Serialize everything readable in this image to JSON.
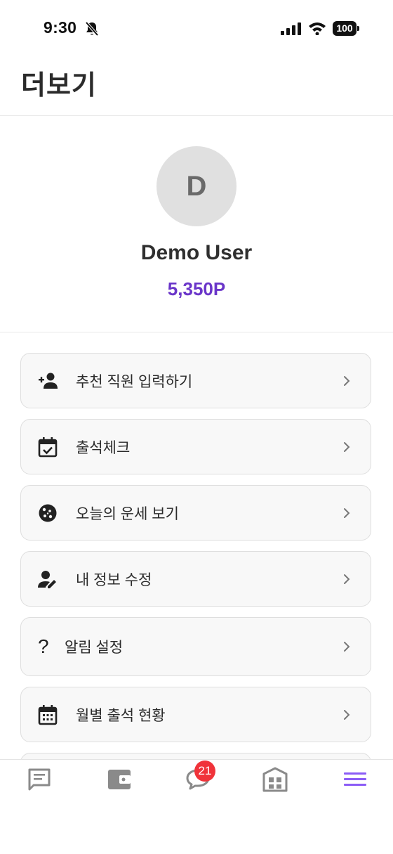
{
  "status_bar": {
    "time": "9:30",
    "battery": "100"
  },
  "header": {
    "title": "더보기"
  },
  "profile": {
    "avatar_initial": "D",
    "name": "Demo User",
    "points": "5,350P"
  },
  "menu": [
    {
      "label": "추천 직원 입력하기",
      "icon": "person-add-icon"
    },
    {
      "label": "출석체크",
      "icon": "calendar-check-icon"
    },
    {
      "label": "오늘의 운세 보기",
      "icon": "cookie-icon"
    },
    {
      "label": "내 정보 수정",
      "icon": "person-edit-icon"
    },
    {
      "label": "알림 설정",
      "icon": "question-mark-icon"
    },
    {
      "label": "월별 출석 현황",
      "icon": "calendar-month-icon"
    }
  ],
  "tab_bar": {
    "tabs": [
      {
        "name": "message-tab",
        "icon": "message-icon"
      },
      {
        "name": "wallet-tab",
        "icon": "wallet-icon"
      },
      {
        "name": "chat-tab",
        "icon": "chat-bubble-icon"
      },
      {
        "name": "building-tab",
        "icon": "building-icon"
      },
      {
        "name": "menu-tab",
        "icon": "hamburger-menu-icon"
      }
    ],
    "chat_badge": "21",
    "active_color": "#8b5cf6",
    "inactive_color": "#8a8a8a"
  },
  "colors": {
    "points": "#6a35c9",
    "badge": "#f0333a"
  }
}
